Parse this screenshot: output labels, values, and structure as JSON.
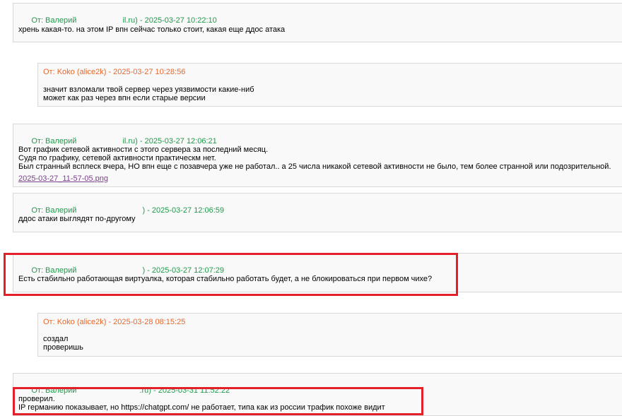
{
  "messages": [
    {
      "header_prefix": "От: Валерий",
      "header_suffix": "il.ru) - 2025-03-27 10:22:10",
      "lines": [
        "хрень какая-то. на этом IP впн сейчас только стоит, какая еще ддос атака"
      ]
    },
    {
      "header": "От: Koko (alice2k) - 2025-03-27 10:28:56",
      "lines": [
        "значит взломали твой сервер через уязвимости какие-ниб",
        "может как раз через впн если старые версии"
      ]
    },
    {
      "header_prefix": "От: Валерий",
      "header_suffix": "il.ru) - 2025-03-27 12:06:21",
      "lines": [
        "Вот график сетевой активности с этого сервера за последний месяц.",
        "Судя по графику, сетевой активности практическм нет.",
        "Был странный всплеск вчера, НО впн еще с позавчера уже не работал.. а 25 числа никакой сетевой активности не было, тем более странной или подозрительной."
      ],
      "attachment": "2025-03-27_11-57-05.png"
    },
    {
      "header_prefix": "От: Валерий",
      "header_suffix": ") - 2025-03-27 12:06:59",
      "lines": [
        "ддос атаки выглядят по-другому"
      ]
    },
    {
      "header_prefix": "От: Валерий",
      "header_suffix": ") - 2025-03-27 12:07:29",
      "lines": [
        "Есть стабильно работающая виртуалка, которая стабильно работать будет, а не блокироваться при первом чихе?"
      ]
    },
    {
      "header": "От: Koko (alice2k) - 2025-03-28 08:15:25",
      "lines": [
        "создал",
        "проверишь"
      ]
    },
    {
      "header_prefix": "От: Валерий",
      "header_suffix": ".ru) - 2025-03-31 11:52:22",
      "lines": [
        "проверил.",
        "IP германию показывает, но https://chatgpt.com/ не работает, типа как из россии трафик похоже видит"
      ]
    }
  ],
  "colors": {
    "client_header": "#1e9a4a",
    "support_header": "#e8672a",
    "highlight": "#e3202a",
    "attachment_link": "#7a3f8a"
  }
}
